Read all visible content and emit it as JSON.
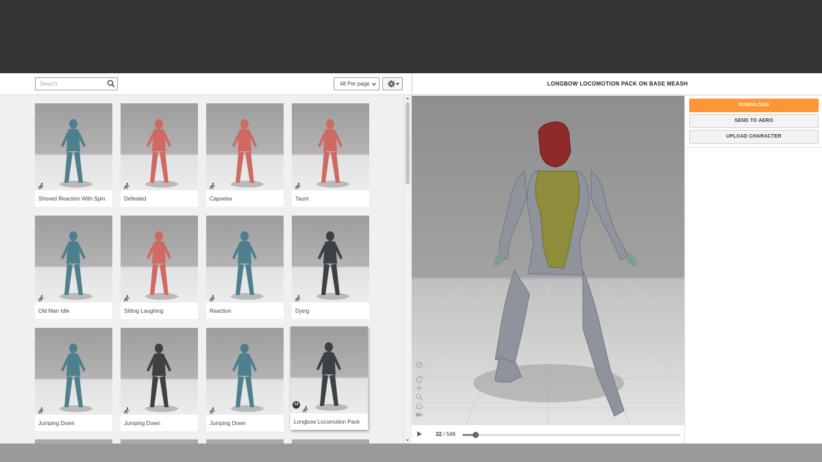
{
  "search": {
    "placeholder": "Search",
    "value": ""
  },
  "toolbar": {
    "per_page": "48 Per page"
  },
  "preview": {
    "title": "LONGBOW LOCOMOTION PACK ON BASE MEASH"
  },
  "actions": {
    "download": "DOWNLOAD",
    "send_to_aero": "SEND TO AERO",
    "upload_character": "UPLOAD CHARACTER"
  },
  "player": {
    "current_frame": "32",
    "separator": "/",
    "total_frames": "546",
    "progress": 0.0586
  },
  "cards": [
    {
      "label": "Shoved Reaction With Spin",
      "model": "blue",
      "icon": "run-icon"
    },
    {
      "label": "Defeated",
      "model": "red",
      "icon": "run-icon"
    },
    {
      "label": "Capoeira",
      "model": "red",
      "icon": "run-icon"
    },
    {
      "label": "Taunt",
      "model": "red",
      "icon": "run-icon"
    },
    {
      "label": "Old Man Idle",
      "model": "blue",
      "icon": "run-icon"
    },
    {
      "label": "Sitting Laughing",
      "model": "red",
      "icon": "run-icon"
    },
    {
      "label": "Reaction",
      "model": "blue",
      "icon": "run-icon"
    },
    {
      "label": "Dying",
      "model": "soldier",
      "icon": "run-icon"
    },
    {
      "label": "Jumping Down",
      "model": "blue",
      "icon": "run-icon"
    },
    {
      "label": "Jumping Down",
      "model": "soldier",
      "icon": "run-icon"
    },
    {
      "label": "Jumping Down",
      "model": "blue",
      "icon": "run-icon"
    },
    {
      "label": "Longbow Locomotion Pack",
      "model": "archer",
      "icon": "run-icon",
      "badge": "12",
      "selected": true
    }
  ],
  "colors": {
    "accent": "#ff9633",
    "blue_model": "#4d7f8e",
    "red_model": "#cf6a63",
    "soldier_model": "#3c4145",
    "preview_body": "#8f949c",
    "preview_helmet": "#8f2a2a",
    "preview_torso": "#8d8d3c"
  }
}
